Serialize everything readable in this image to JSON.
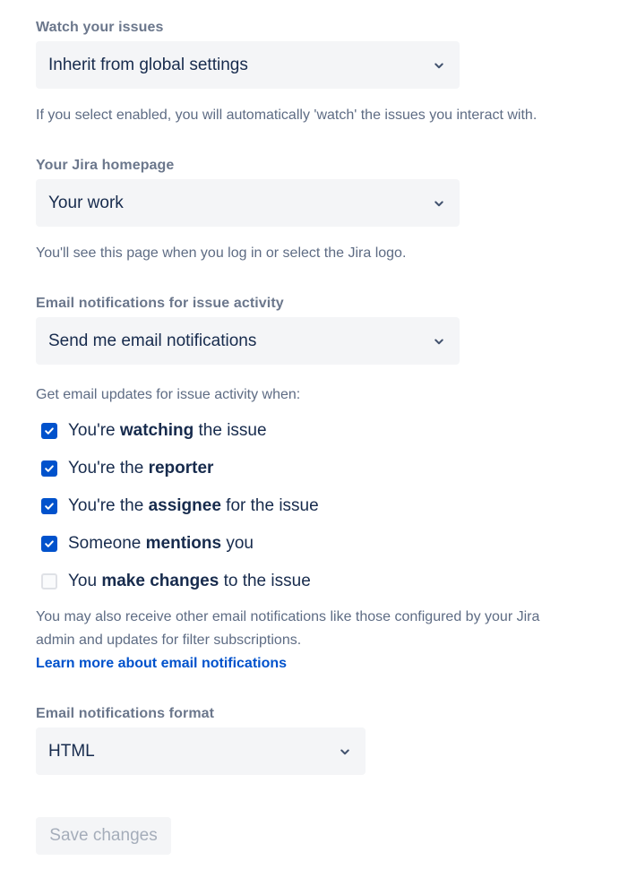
{
  "watch_issues": {
    "label": "Watch your issues",
    "value": "Inherit from global settings",
    "helper": "If you select enabled, you will automatically 'watch' the issues you interact with."
  },
  "homepage": {
    "label": "Your Jira homepage",
    "value": "Your work",
    "helper": "You'll see this page when you log in or select the Jira logo."
  },
  "email_activity": {
    "label": "Email notifications for issue activity",
    "value": "Send me email notifications",
    "intro": "Get email updates for issue activity when:",
    "options": [
      {
        "pre": "You're ",
        "bold": "watching",
        "post": " the issue",
        "checked": true
      },
      {
        "pre": "You're the ",
        "bold": "reporter",
        "post": "",
        "checked": true
      },
      {
        "pre": "You're the ",
        "bold": "assignee",
        "post": " for the issue",
        "checked": true
      },
      {
        "pre": "Someone ",
        "bold": "mentions",
        "post": " you",
        "checked": true
      },
      {
        "pre": "You ",
        "bold": "make changes",
        "post": " to the issue",
        "checked": false
      }
    ],
    "note_line1": "You may also receive other email notifications like those configured by your Jira",
    "note_line2": "admin and updates for filter subscriptions.",
    "learn_more": "Learn more about email notifications"
  },
  "email_format": {
    "label": "Email notifications format",
    "value": "HTML"
  },
  "save_label": "Save changes",
  "colors": {
    "accent": "#0052cc",
    "select_bg": "#f4f5f7",
    "label": "#6b778c",
    "helper": "#5e6c84",
    "text": "#172b4d",
    "disabled_text": "#a5adba"
  }
}
